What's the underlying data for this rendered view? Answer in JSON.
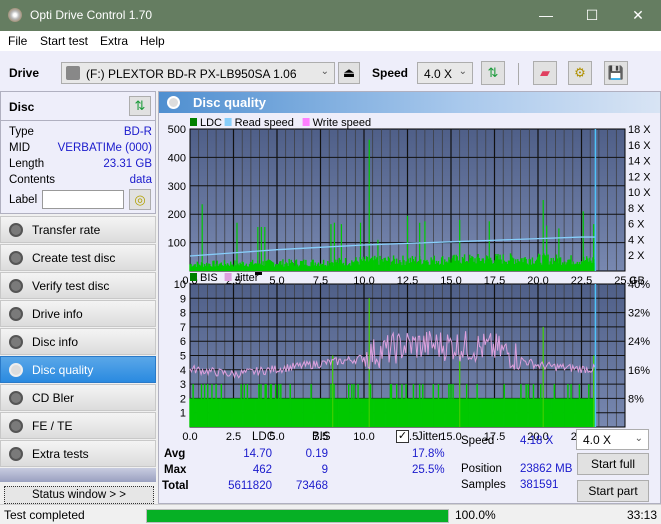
{
  "window": {
    "title": "Opti Drive Control 1.70",
    "minimize": "—",
    "maximize": "☐",
    "close": "✕"
  },
  "menu": [
    "File",
    "Start test",
    "Extra",
    "Help"
  ],
  "toolbar": {
    "drive_label": "Drive",
    "drive_value": "(F:)  PLEXTOR BD-R  PX-LB950SA 1.06",
    "speed_label": "Speed",
    "speed_value": "4.0 X",
    "icons": [
      "eject-icon",
      "refresh-icon",
      "eraser-icon",
      "settings-icon",
      "save-icon"
    ]
  },
  "disc": {
    "header": "Disc",
    "rows": [
      {
        "label": "Type",
        "value": "BD-R"
      },
      {
        "label": "MID",
        "value": "VERBATIMe (000)"
      },
      {
        "label": "Length",
        "value": "23.31 GB"
      },
      {
        "label": "Contents",
        "value": "data"
      }
    ],
    "label_label": "Label",
    "label_value": ""
  },
  "nav": [
    {
      "label": "Transfer rate",
      "active": false
    },
    {
      "label": "Create test disc",
      "active": false
    },
    {
      "label": "Verify test disc",
      "active": false
    },
    {
      "label": "Drive info",
      "active": false
    },
    {
      "label": "Disc info",
      "active": false
    },
    {
      "label": "Disc quality",
      "active": true
    },
    {
      "label": "CD Bler",
      "active": false
    },
    {
      "label": "FE / TE",
      "active": false
    },
    {
      "label": "Extra tests",
      "active": false
    }
  ],
  "status_window_label": "Status window > >",
  "panel_title": "Disc quality",
  "chart_data": [
    {
      "type": "bar",
      "title": "LDC",
      "legend": [
        "LDC",
        "Read speed",
        "Write speed"
      ],
      "legend_colors": [
        "#008000",
        "#87cefa",
        "#ff80ff"
      ],
      "xlabel": "GB",
      "x_ticks": [
        "0.0",
        "2.5",
        "5.0",
        "7.5",
        "10.0",
        "12.5",
        "15.0",
        "17.5",
        "20.0",
        "22.5",
        "25.0"
      ],
      "xlim": [
        0,
        25
      ],
      "ylim": [
        0,
        500
      ],
      "y_ticks": [
        100,
        200,
        300,
        400,
        500
      ],
      "y2_ticks": [
        "2 X",
        "4 X",
        "6 X",
        "8 X",
        "10 X",
        "12 X",
        "14 X",
        "16 X",
        "18 X"
      ],
      "y2lim": [
        0,
        18
      ],
      "ldc_baseline": [
        [
          0,
          25
        ],
        [
          2.5,
          28
        ],
        [
          5,
          30
        ],
        [
          7.5,
          32
        ],
        [
          10,
          38
        ],
        [
          12.5,
          40
        ],
        [
          15,
          42
        ],
        [
          17.5,
          45
        ],
        [
          20,
          45
        ],
        [
          22.5,
          40
        ],
        [
          23.3,
          40
        ]
      ],
      "ldc_spikes": [
        [
          0.7,
          235
        ],
        [
          2.7,
          170
        ],
        [
          3.9,
          155
        ],
        [
          4.1,
          155
        ],
        [
          4.3,
          155
        ],
        [
          8.1,
          165
        ],
        [
          8.3,
          170
        ],
        [
          8.7,
          165
        ],
        [
          9.8,
          170
        ],
        [
          10.3,
          462
        ],
        [
          10.8,
          110
        ],
        [
          12.5,
          195
        ],
        [
          13.2,
          170
        ],
        [
          13.5,
          175
        ],
        [
          15.5,
          180
        ],
        [
          17.2,
          175
        ],
        [
          20.3,
          250
        ],
        [
          20.5,
          160
        ],
        [
          21.2,
          150
        ],
        [
          22.6,
          210
        ],
        [
          23.2,
          165
        ]
      ],
      "read_speed": [
        [
          0,
          1.9
        ],
        [
          2.5,
          2.3
        ],
        [
          5,
          2.7
        ],
        [
          7.5,
          3.0
        ],
        [
          10,
          3.3
        ],
        [
          12.5,
          3.5
        ],
        [
          15,
          3.7
        ],
        [
          17.5,
          3.9
        ],
        [
          20,
          4.1
        ],
        [
          22.5,
          4.3
        ],
        [
          23.3,
          4.3
        ]
      ],
      "end_marker_gb": 23.3
    },
    {
      "type": "bar",
      "title": "BIS / Jitter",
      "legend": [
        "BIS",
        "Jitter"
      ],
      "legend_colors": [
        "#008000",
        "#dda0dd"
      ],
      "xlabel": "GB",
      "x_ticks": [
        "0.0",
        "2.5",
        "5.0",
        "7.5",
        "10.0",
        "12.5",
        "15.0",
        "17.5",
        "20.0",
        "22.5",
        "25.0"
      ],
      "xlim": [
        0,
        25
      ],
      "ylim": [
        0,
        10
      ],
      "y_ticks": [
        1,
        2,
        3,
        4,
        5,
        6,
        7,
        8,
        9,
        10
      ],
      "y2_ticks": [
        "8%",
        "16%",
        "24%",
        "32%",
        "40%"
      ],
      "y2lim": [
        0,
        40
      ],
      "bis_level": 2,
      "bis_spikes": [
        [
          10.3,
          9
        ],
        [
          20.3,
          7
        ],
        [
          8.2,
          5
        ],
        [
          15.5,
          5
        ],
        [
          23.2,
          5
        ]
      ],
      "jitter": [
        [
          0,
          16
        ],
        [
          2.5,
          14.5
        ],
        [
          5,
          16
        ],
        [
          7.5,
          17.5
        ],
        [
          10,
          19
        ],
        [
          12.5,
          22
        ],
        [
          15,
          22
        ],
        [
          17.5,
          21
        ],
        [
          20,
          17
        ],
        [
          22.5,
          16
        ],
        [
          23.3,
          16
        ]
      ],
      "end_marker_gb": 23.3
    }
  ],
  "stats": {
    "col_ldc": "LDC",
    "col_bis": "BIS",
    "rows": [
      {
        "label": "Avg",
        "ldc": "14.70",
        "bis": "0.19",
        "jitter": "17.8%"
      },
      {
        "label": "Max",
        "ldc": "462",
        "bis": "9",
        "jitter": "25.5%"
      },
      {
        "label": "Total",
        "ldc": "5611820",
        "bis": "73468"
      }
    ],
    "jitter_label": "Jitter",
    "jitter_checked": true,
    "speed_label": "Speed",
    "speed_value": "4.18 X",
    "position_label": "Position",
    "position_value": "23862 MB",
    "samples_label": "Samples",
    "samples_value": "381591",
    "speed_select": "4.0 X",
    "start_full": "Start full",
    "start_part": "Start part"
  },
  "statusbar": {
    "text": "Test completed",
    "progress_percent": 100.0,
    "progress_label": "100.0%",
    "time": "33:13"
  }
}
